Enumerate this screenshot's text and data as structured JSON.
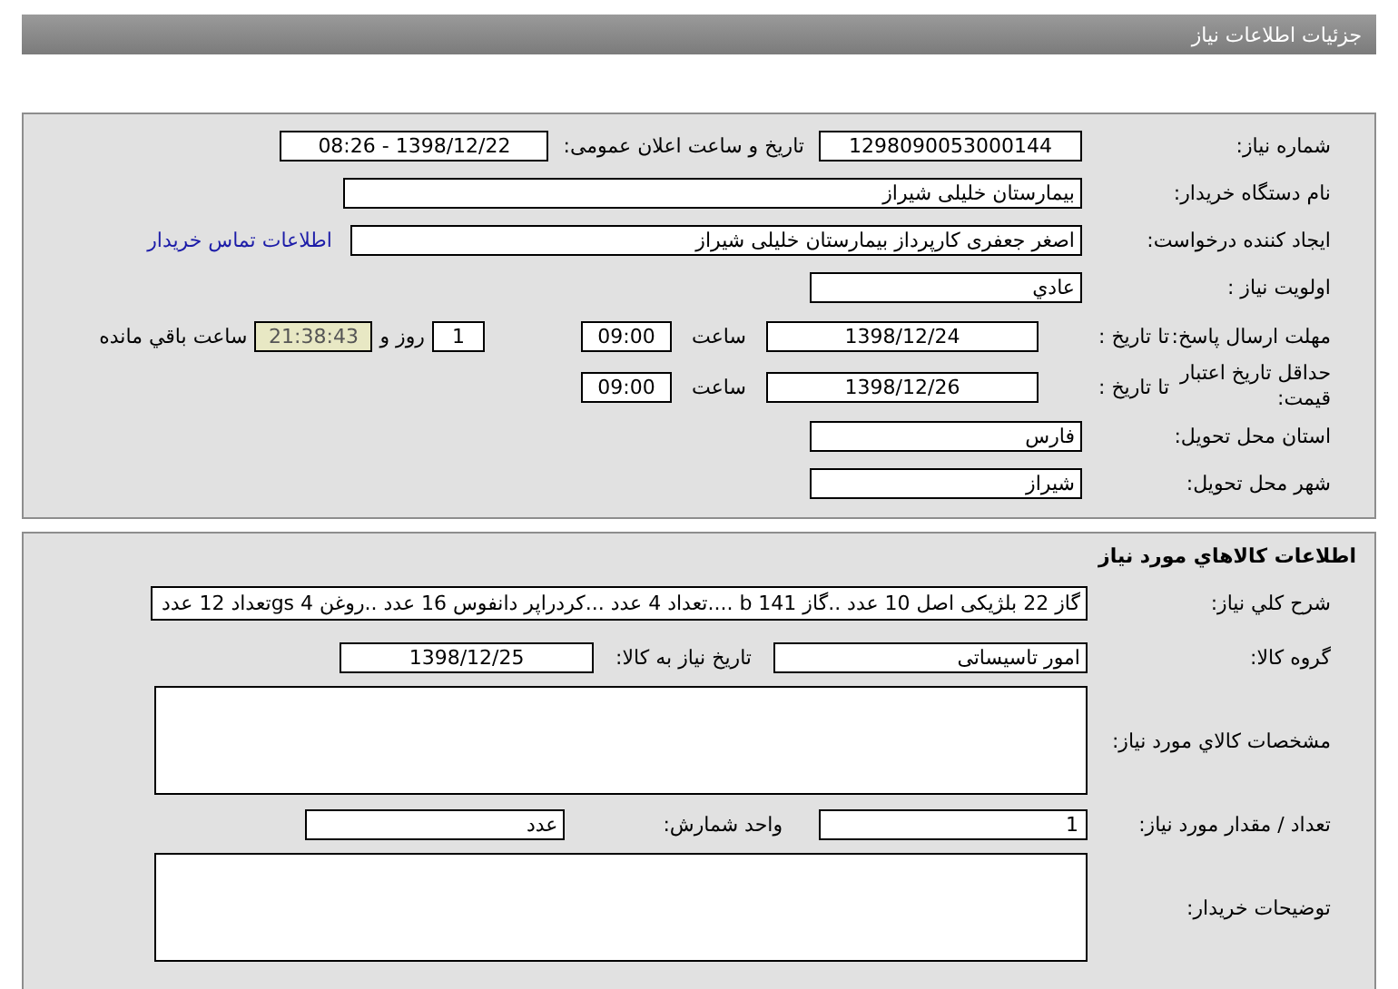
{
  "header": {
    "title": "جزئیات اطلاعات نیاز"
  },
  "need_info": {
    "need_number": {
      "label": "شماره نیاز:",
      "value": "1298090053000144"
    },
    "announce": {
      "label": "تاریخ و ساعت اعلان عمومی:",
      "value": "1398/12/22 - 08:26"
    },
    "buyer_org": {
      "label": "نام دستگاه خریدار:",
      "value": "بیمارستان خلیلی شیراز"
    },
    "requester": {
      "label": "ایجاد کننده درخواست:",
      "value": "اصغر جعفری کارپرداز بیمارستان خلیلی شیراز",
      "link": "اطلاعات تماس خریدار"
    },
    "priority": {
      "label": "اولویت نیاز :",
      "value": "عادي"
    },
    "deadline": {
      "label": "مهلت ارسال پاسخ:",
      "to_date_label": "تا تاریخ :",
      "date": "1398/12/24",
      "time_label": "ساعت",
      "time": "09:00",
      "days": "1",
      "days_label": "روز و",
      "remaining": "21:38:43",
      "remaining_label": "ساعت باقي مانده"
    },
    "validity": {
      "label": "حداقل تاریخ اعتبار قیمت:",
      "to_date_label": "تا تاریخ :",
      "date": "1398/12/26",
      "time_label": "ساعت",
      "time": "09:00"
    },
    "province": {
      "label": "استان محل تحویل:",
      "value": "فارس"
    },
    "city": {
      "label": "شهر محل تحویل:",
      "value": "شیراز"
    }
  },
  "goods": {
    "title": "اطلاعات کالاهاي مورد نياز",
    "description": {
      "label": "شرح کلي نياز:",
      "value": "گاز 22 بلژیکی اصل 10 عدد ..گاز 141 b ....تعداد  4 عدد ...کردراپر دانفوس 16 عدد ..روغن 4 gsتعداد 12 عدد"
    },
    "group": {
      "label": "گروه کالا:",
      "value": "امور تاسیساتی"
    },
    "need_date": {
      "label": "تاریخ نیاز به کالا:",
      "value": "1398/12/25"
    },
    "specs": {
      "label": "مشخصات کالاي مورد نياز:"
    },
    "quantity": {
      "label": "تعداد / مقدار مورد نیاز:",
      "value": "1"
    },
    "unit": {
      "label": "واحد شمارش:",
      "value": "عدد"
    },
    "buyer_notes": {
      "label": "توضیحات خریدار:"
    }
  }
}
